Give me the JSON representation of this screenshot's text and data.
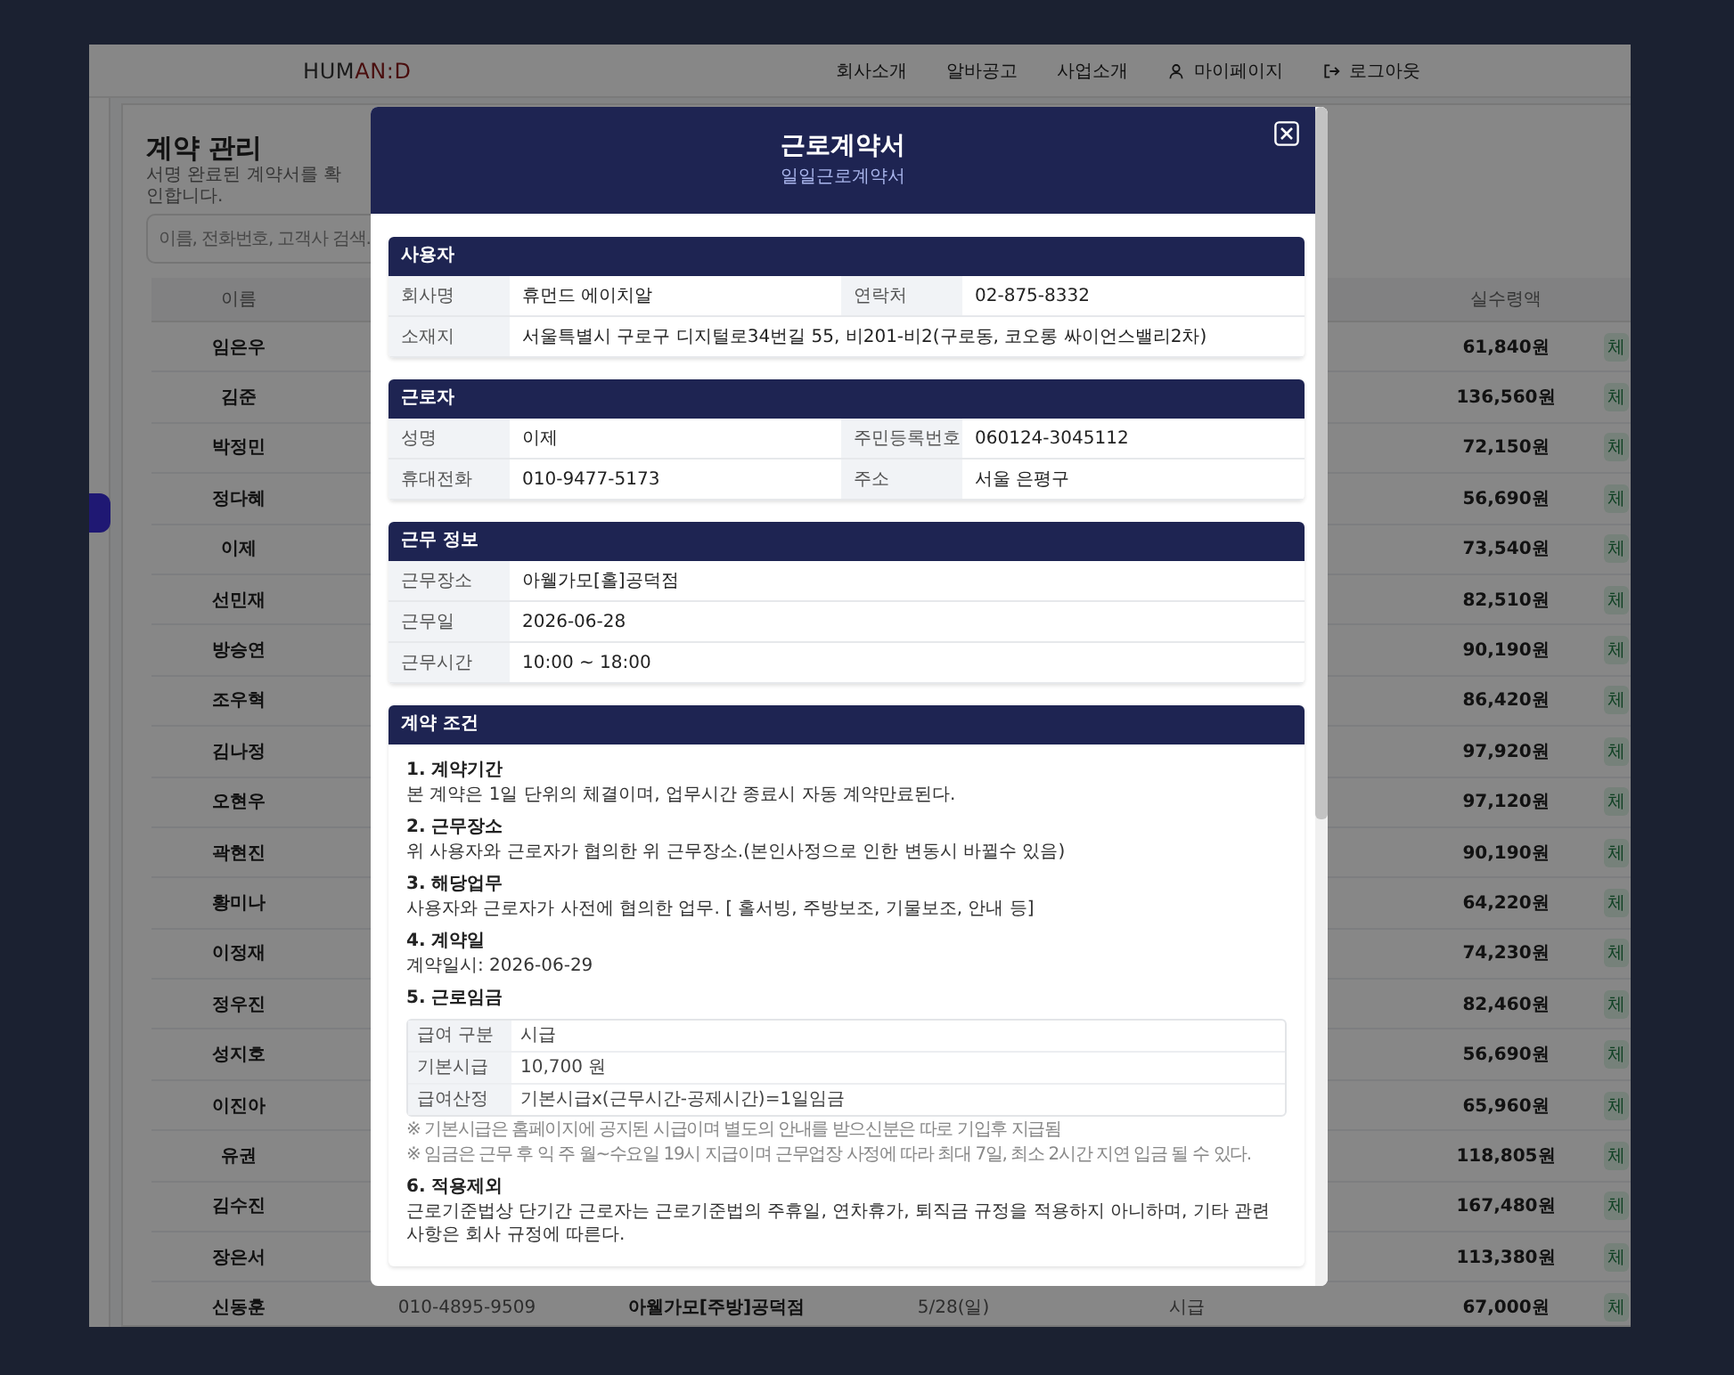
{
  "header": {
    "logo": [
      {
        "text": "HUM",
        "accent": false
      },
      {
        "text": "AN:D",
        "accent": true
      }
    ],
    "nav": [
      {
        "label": "회사소개",
        "kind": "link"
      },
      {
        "label": "알바공고",
        "kind": "link"
      },
      {
        "label": "사업소개",
        "kind": "link"
      },
      {
        "label": "마이페이지",
        "kind": "user"
      },
      {
        "label": "로그아웃",
        "kind": "logout"
      }
    ]
  },
  "sidebar": {
    "items": [
      {
        "selected": true
      }
    ]
  },
  "page": {
    "title": "계약 관리",
    "subtitle": "서명 완료된 계약서를 확인합니다.",
    "search": {
      "placeholder": "이름, 전화번호, 고객사 검색."
    }
  },
  "table": {
    "columns": {
      "name": "이름",
      "amount": "실수령액"
    },
    "rows": [
      {
        "name": "임은우",
        "amount": "61,840원",
        "status": "체"
      },
      {
        "name": "김준",
        "amount": "136,560원",
        "status": "체"
      },
      {
        "name": "박정민",
        "amount": "72,150원",
        "status": "체"
      },
      {
        "name": "정다혜",
        "amount": "56,690원",
        "status": "체"
      },
      {
        "name": "이제",
        "amount": "73,540원",
        "status": "체"
      },
      {
        "name": "선민재",
        "amount": "82,510원",
        "status": "체"
      },
      {
        "name": "방승연",
        "amount": "90,190원",
        "status": "체"
      },
      {
        "name": "조우혁",
        "amount": "86,420원",
        "status": "체"
      },
      {
        "name": "김나정",
        "amount": "97,920원",
        "status": "체"
      },
      {
        "name": "오현우",
        "amount": "97,120원",
        "status": "체"
      },
      {
        "name": "곽현진",
        "amount": "90,190원",
        "status": "체"
      },
      {
        "name": "황미나",
        "amount": "64,220원",
        "status": "체"
      },
      {
        "name": "이정재",
        "amount": "74,230원",
        "status": "체"
      },
      {
        "name": "정우진",
        "amount": "82,460원",
        "status": "체"
      },
      {
        "name": "성지호",
        "amount": "56,690원",
        "status": "체"
      },
      {
        "name": "이진아",
        "amount": "65,960원",
        "status": "체"
      },
      {
        "name": "유권",
        "amount": "118,805원",
        "status": "체"
      },
      {
        "name": "김수진",
        "amount": "167,480원",
        "status": "체"
      },
      {
        "name": "장은서",
        "amount": "113,380원",
        "status": "체"
      },
      {
        "name": "신동훈",
        "phone": "010-4895-9509",
        "workplace": "아웰가모[주방]공덕점",
        "date": "5/28(일)",
        "wage_type": "시급",
        "amount": "67,000원",
        "status": "체"
      }
    ]
  },
  "modal": {
    "title": "근로계약서",
    "subtitle": "일일근로계약서",
    "sections": [
      {
        "title": "사용자",
        "kind": "fields",
        "rows": [
          [
            {
              "label": "회사명",
              "value": "휴먼드 에이치알"
            },
            {
              "label": "연락처",
              "value": "02-875-8332"
            }
          ],
          [
            {
              "label": "소재지",
              "value": "서울특별시 구로구 디지털로34번길 55, 비201-비2(구로동, 코오롱 싸이언스밸리2차)"
            }
          ]
        ]
      },
      {
        "title": "근로자",
        "kind": "fields",
        "rows": [
          [
            {
              "label": "성명",
              "value": "이제"
            },
            {
              "label": "주민등록번호",
              "value": "060124-3045112"
            }
          ],
          [
            {
              "label": "휴대전화",
              "value": "010-9477-5173"
            },
            {
              "label": "주소",
              "value": "서울 은평구"
            }
          ]
        ]
      },
      {
        "title": "근무 정보",
        "kind": "fields",
        "rows": [
          [
            {
              "label": "근무장소",
              "value": "아웰가모[홀]공덕점"
            }
          ],
          [
            {
              "label": "근무일",
              "value": "2026-06-28"
            }
          ],
          [
            {
              "label": "근무시간",
              "value": "10:00 ~ 18:00"
            }
          ]
        ]
      },
      {
        "title": "계약 조건",
        "kind": "terms",
        "items": [
          {
            "title": "1. 계약기간",
            "text": "본 계약은 1일 단위의 체결이며, 업무시간 종료시 자동 계약만료된다."
          },
          {
            "title": "2. 근무장소",
            "text": "위 사용자와 근로자가 협의한 위 근무장소.(본인사정으로 인한 변동시 바뀔수 있음)"
          },
          {
            "title": "3. 해당업무",
            "text": "사용자와 근로자가 사전에 협의한 업무. [ 홀서빙, 주방보조, 기물보조, 안내 등]"
          },
          {
            "title": "4. 계약일",
            "text": "계약일시: 2026-06-29"
          },
          {
            "title": "5. 근로임금",
            "table": [
              {
                "label": "급여 구분",
                "value": "시급"
              },
              {
                "label": "기본시급",
                "value": "10,700 원"
              },
              {
                "label": "급여산정",
                "value": "기본시급x(근무시간-공제시간)=1일임금"
              }
            ],
            "notes": [
              "※ 기본시급은 홈페이지에 공지된 시급이며 별도의 안내를 받으신분은 따로 기입후 지급됨",
              "※ 임금은 근무 후 익 주 월~수요일 19시 지급이며 근무업장 사정에 따라 최대 7일, 최소 2시간 지연 입금 될 수 있다."
            ]
          },
          {
            "title": "6. 적용제외",
            "text": "근로기준법상 단기간 근로자는 근로기준법의 주휴일, 연차휴가, 퇴직금 규정을 적용하지 아니하며, 기타 관련 사항은 회사 규정에 따른다."
          }
        ]
      }
    ]
  }
}
